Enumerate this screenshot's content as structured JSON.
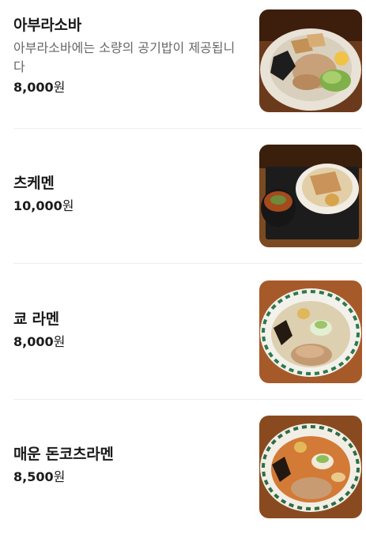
{
  "menu": {
    "items": [
      {
        "name": "아부라소바",
        "description": "아부라소바에는 소량의 공기밥이 제공됩니다",
        "price": "8,000",
        "currency": "원",
        "image": "abura-soba-photo"
      },
      {
        "name": "츠케멘",
        "price": "10,000",
        "currency": "원",
        "image": "tsukemen-photo"
      },
      {
        "name": "쿄 라멘",
        "price": "8,000",
        "currency": "원",
        "image": "kyo-ramen-photo"
      },
      {
        "name": "매운 돈코츠라멘",
        "price": "8,500",
        "currency": "원",
        "image": "spicy-tonkotsu-ramen-photo"
      }
    ]
  }
}
